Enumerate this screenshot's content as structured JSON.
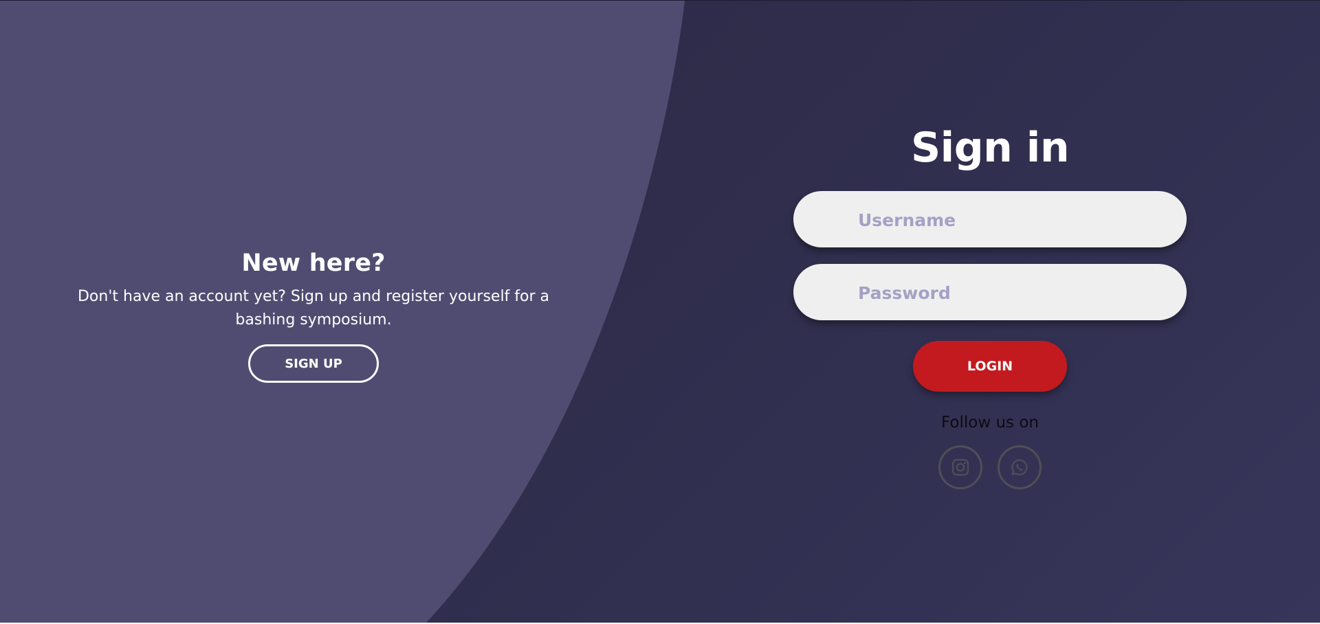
{
  "colors": {
    "background_dark": "#2e2c4a",
    "left_panel": "#504c71",
    "login_button": "#c31a1f",
    "input_background": "#efefef",
    "placeholder_text": "#a4a1c6",
    "social_icon": "#4f4f56"
  },
  "left_panel": {
    "title": "New here?",
    "text": "Don't have an account yet? Sign up and register yourself for a bashing symposium.",
    "signup_label": "SIGN UP"
  },
  "sign_in": {
    "title": "Sign in",
    "username_placeholder": "Username",
    "password_placeholder": "Password",
    "login_label": "LOGIN",
    "follow_text": "Follow us on"
  },
  "social": {
    "icons": [
      "instagram-icon",
      "whatsapp-icon"
    ]
  }
}
